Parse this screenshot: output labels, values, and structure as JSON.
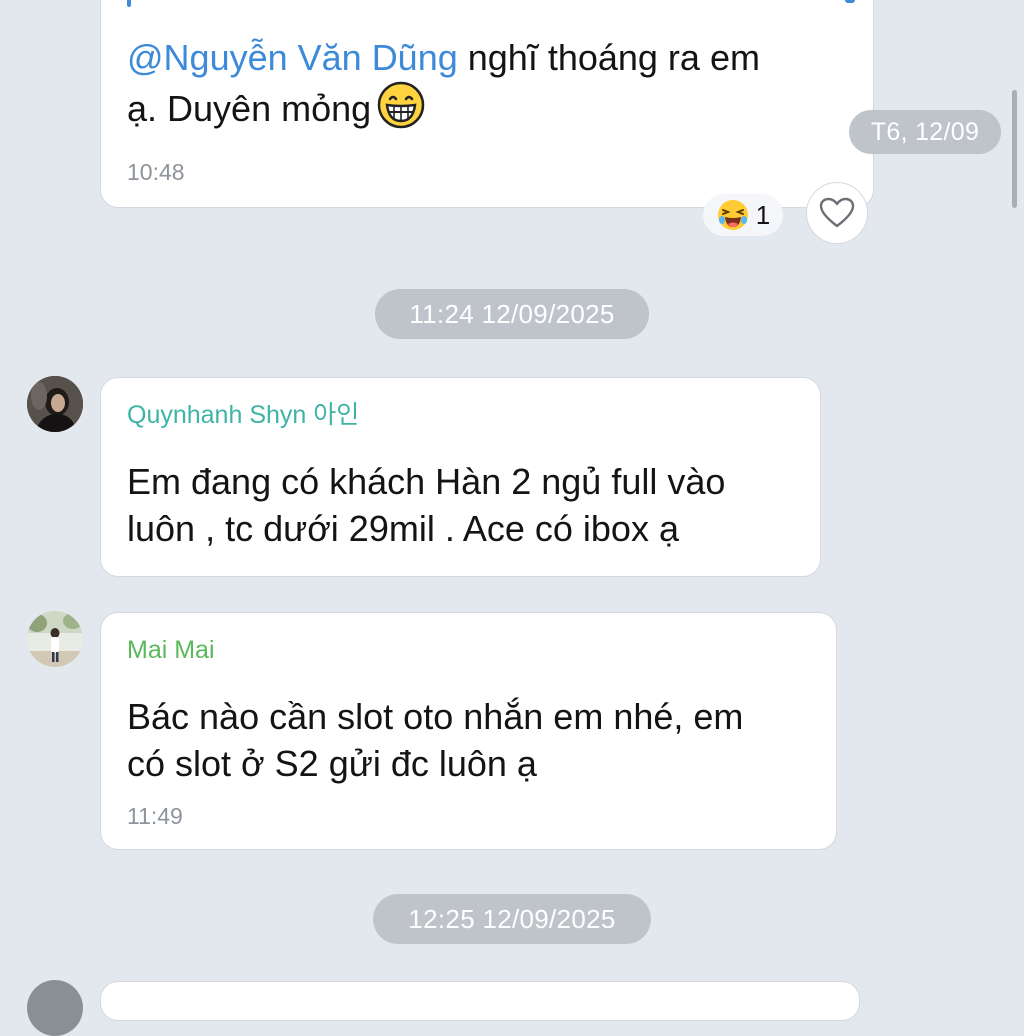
{
  "messages": [
    {
      "mention": "@Nguyễn Văn Dũng",
      "line1_rest": " nghĩ thoáng ra em",
      "line2": "ạ. Duyên mỏng",
      "time": "10:48",
      "reaction_icon": "laughing-face-icon",
      "reaction_count": "1"
    },
    {
      "sender": "Quynhanh Shyn 아인",
      "sender_color": "#3fb3a6",
      "line1": "Em đang có khách Hàn 2 ngủ full vào",
      "line2": "luôn , tc dưới 29mil . Ace có ibox ạ"
    },
    {
      "sender": "Mai Mai",
      "sender_color": "#5cb85c",
      "line1": "Bác nào cần slot oto nhắn em nhé, em",
      "line2": "có slot ở S2 gửi đc luôn ạ",
      "time": "11:49"
    }
  ],
  "date_dividers": [
    "11:24 12/09/2025",
    "12:25 12/09/2025"
  ],
  "floating_date": "T6, 12/09",
  "colors": {
    "background": "#e3e7ee",
    "mention": "#3d8ad9",
    "pill": "#bfc4cb"
  }
}
